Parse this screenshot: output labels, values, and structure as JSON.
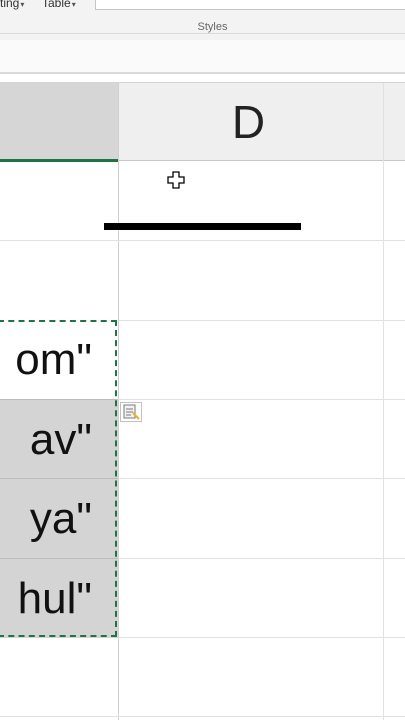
{
  "ribbon": {
    "button1_label": "ting",
    "button2_label": "Table",
    "caret": "▾",
    "group_label": "Styles"
  },
  "column_headers": {
    "d_label": "D"
  },
  "cells": {
    "c_values": [
      "om\"",
      "av\"",
      "ya\"",
      "hul\""
    ]
  },
  "icons": {
    "cursor": "cell-select-cross-icon",
    "paste": "paste-options-icon"
  },
  "colors": {
    "selection_border": "#217346",
    "selected_fill": "#d4d4d4"
  }
}
